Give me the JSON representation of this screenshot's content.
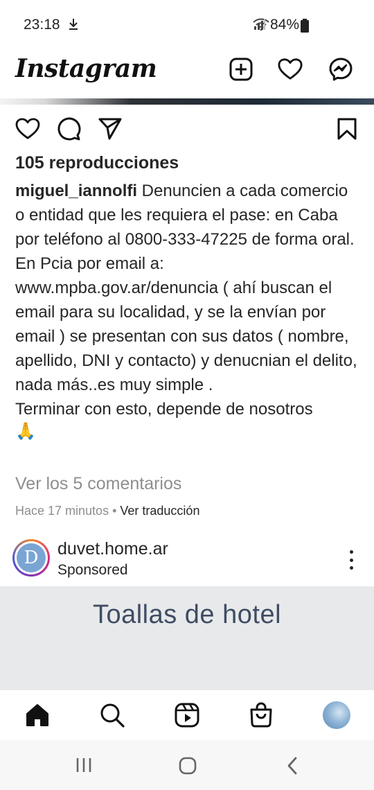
{
  "status_bar": {
    "time": "23:18",
    "battery": "84%",
    "icons": [
      "download-icon",
      "wifi-icon",
      "signal-icon",
      "battery-icon"
    ]
  },
  "header": {
    "logo": "Instagram",
    "icons": [
      "new-post-icon",
      "heart-icon",
      "messenger-icon"
    ]
  },
  "post": {
    "actions": [
      "like-icon",
      "comment-icon",
      "share-icon",
      "save-icon"
    ],
    "views": "105 reproducciones",
    "username": "miguel_iannolfi",
    "caption": " Denuncien a cada comercio o entidad que les requiera el pase: en Caba por teléfono al 0800-333-47225 de forma oral. En Pcia por email a: www.mpba.gov.ar/denuncia ( ahí buscan el email para su localidad, y se la envían por email ) se presentan con sus datos ( nombre, apellido, DNI y contacto) y denucnian el delito, nada más..es muy simple .",
    "caption_2": "Terminar con esto, depende de nosotros",
    "emoji": "🙏",
    "comments_link": "Ver los 5 comentarios",
    "time_ago": "Hace 17 minutos",
    "separator": " • ",
    "translate": "Ver traducción"
  },
  "sponsored": {
    "avatar_letter": "D",
    "account": "duvet.home.ar",
    "label": "Sponsored",
    "ad_text": "Toallas de hotel"
  },
  "bottom_nav": [
    "home-icon",
    "search-icon",
    "reels-icon",
    "shop-icon",
    "profile-avatar"
  ],
  "system_nav": [
    "recents-button",
    "home-button",
    "back-button"
  ],
  "colors": {
    "text": "#262626",
    "secondary": "#8e8e8e",
    "ad_background": "#e8e9eb",
    "ad_text": "#3e4d63"
  }
}
